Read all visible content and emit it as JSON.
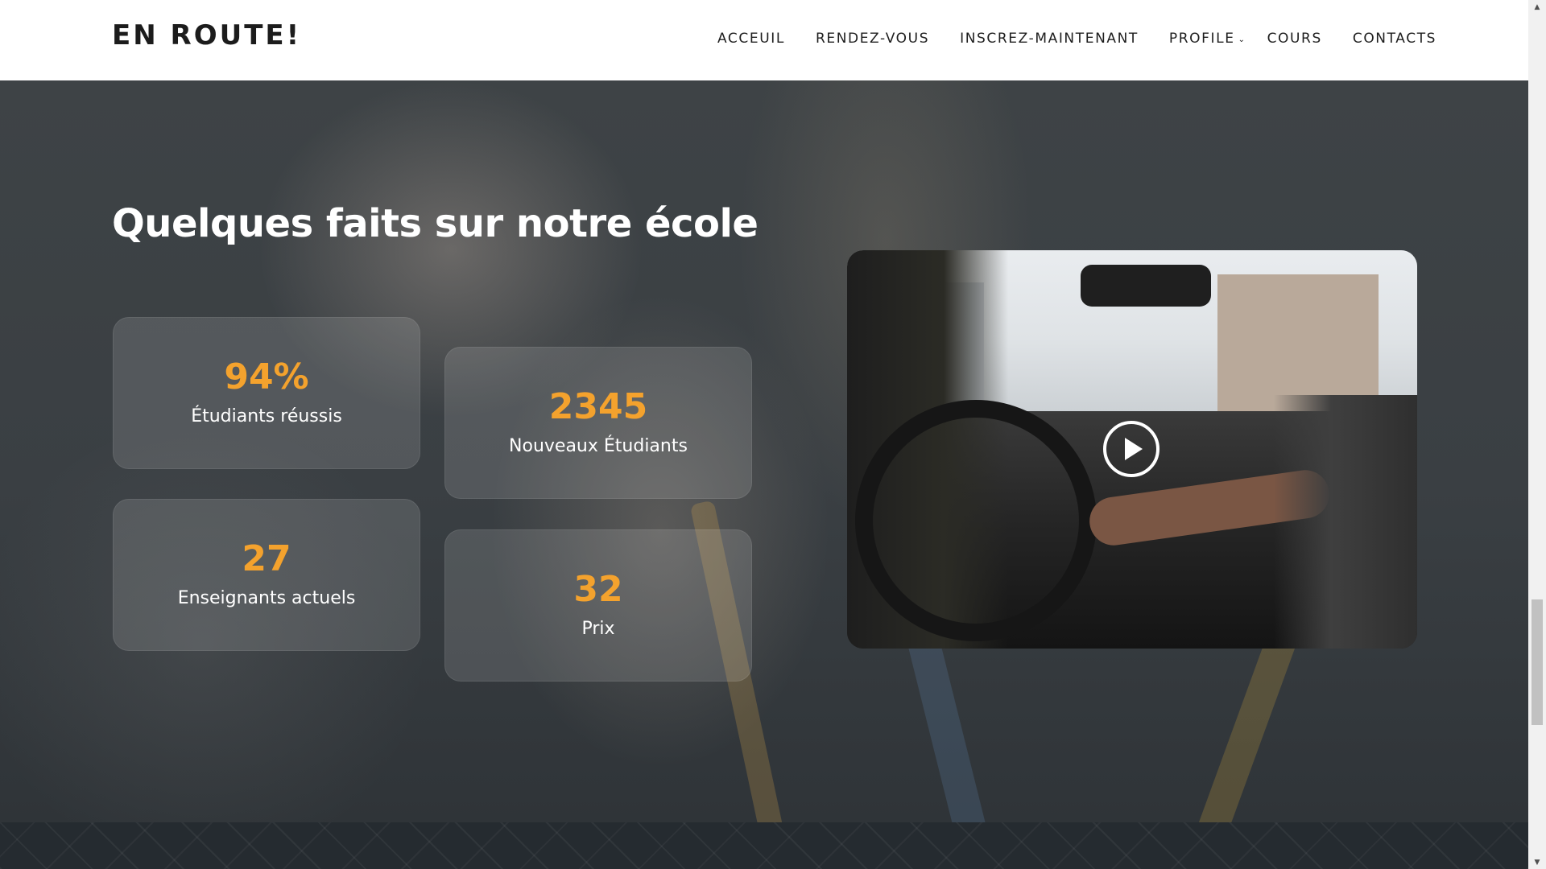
{
  "header": {
    "logo": "EN ROUTE!",
    "nav": [
      {
        "label": "ACCEUIL"
      },
      {
        "label": "RENDEZ-VOUS"
      },
      {
        "label": "INSCREZ-MAINTENANT"
      },
      {
        "label": "PROFILE",
        "has_dropdown": true
      },
      {
        "label": "COURS"
      },
      {
        "label": "CONTACTS"
      }
    ]
  },
  "facts": {
    "title": "Quelques faits sur notre école",
    "stats": [
      {
        "value": "94%",
        "label": "Étudiants réussis"
      },
      {
        "value": "2345",
        "label": "Nouveaux Étudiants"
      },
      {
        "value": "27",
        "label": "Enseignants actuels"
      },
      {
        "value": "32",
        "label": "Prix"
      }
    ]
  },
  "video": {
    "icon": "play-icon"
  },
  "colors": {
    "accent": "#f4a22d",
    "header_bg": "#ffffff",
    "hero_overlay": "#3a3f43",
    "text_light": "#ffffff"
  }
}
